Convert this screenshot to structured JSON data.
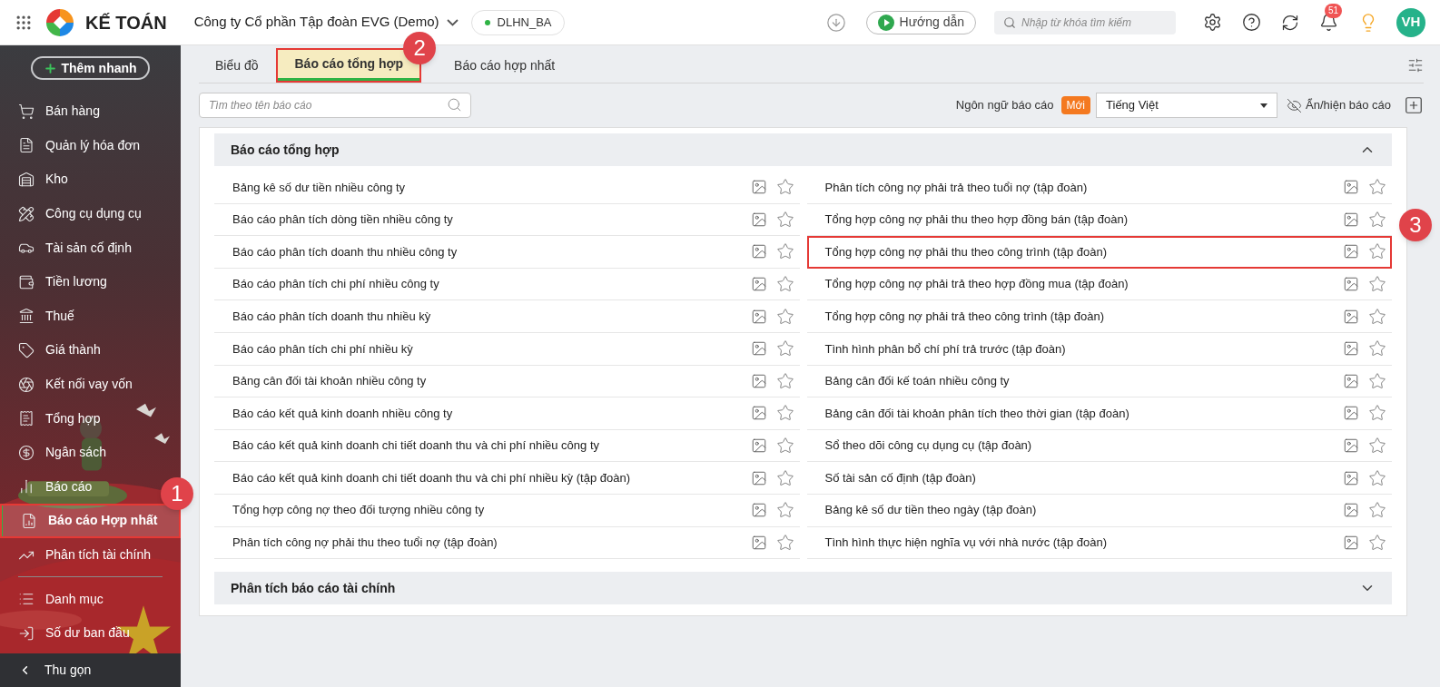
{
  "header": {
    "logo_text": "KẾ TOÁN",
    "company": "Công ty Cổ phần Tập đoàn EVG (Demo)",
    "branch": "DLHN_BA",
    "guide_button": "Hướng dẫn",
    "search_placeholder": "Nhập từ khóa tìm kiếm",
    "notification_count": "51",
    "avatar": "VH"
  },
  "sidebar": {
    "quick_add": "Thêm nhanh",
    "collapse": "Thu gọn",
    "items": [
      {
        "label": "Bán hàng",
        "selected": false
      },
      {
        "label": "Quản lý hóa đơn",
        "selected": false
      },
      {
        "label": "Kho",
        "selected": false
      },
      {
        "label": "Công cụ dụng cụ",
        "selected": false
      },
      {
        "label": "Tài sản cố định",
        "selected": false
      },
      {
        "label": "Tiền lương",
        "selected": false
      },
      {
        "label": "Thuế",
        "selected": false
      },
      {
        "label": "Giá thành",
        "selected": false
      },
      {
        "label": "Kết nối vay vốn",
        "selected": false
      },
      {
        "label": "Tổng hợp",
        "selected": false
      },
      {
        "label": "Ngân sách",
        "selected": false
      },
      {
        "label": "Báo cáo",
        "selected": false
      },
      {
        "label": "Báo cáo Hợp nhất",
        "selected": true,
        "callout": "1"
      },
      {
        "label": "Phân tích tài chính",
        "selected": false
      },
      {
        "label": "Danh mục",
        "selected": false
      },
      {
        "label": "Số dư ban đầu",
        "selected": false
      }
    ]
  },
  "tabs": [
    {
      "label": "Biểu đồ",
      "selected": false
    },
    {
      "label": "Báo cáo tổng hợp",
      "selected": true,
      "callout": "2"
    },
    {
      "label": "Báo cáo hợp nhất",
      "selected": false
    }
  ],
  "toolbar": {
    "search_placeholder": "Tìm theo tên báo cáo",
    "language_label": "Ngôn ngữ báo cáo",
    "new_badge": "Mới",
    "language_value": "Tiếng Việt",
    "toggle_label": "Ẩn/hiện báo cáo"
  },
  "sections": [
    {
      "title": "Báo cáo tổng hợp",
      "expanded": true,
      "columns": [
        [
          {
            "name": "Bảng kê số dư tiền nhiều công ty",
            "starred": false
          },
          {
            "name": "Báo cáo phân tích dòng tiền nhiều công ty",
            "starred": false
          },
          {
            "name": "Báo cáo phân tích doanh thu nhiều công ty",
            "starred": false
          },
          {
            "name": "Báo cáo phân tích chi phí nhiều công ty",
            "starred": false
          },
          {
            "name": "Báo cáo phân tích doanh thu nhiều kỳ",
            "starred": false
          },
          {
            "name": "Báo cáo phân tích chi phí nhiều kỳ",
            "starred": false
          },
          {
            "name": "Bảng cân đối tài khoản nhiều công ty",
            "starred": false
          },
          {
            "name": "Báo cáo kết quả kinh doanh nhiều công ty",
            "starred": false
          },
          {
            "name": "Báo cáo kết quả kinh doanh chi tiết doanh thu và chi phí nhiều công ty",
            "starred": false
          },
          {
            "name": "Báo cáo kết quả kinh doanh chi tiết doanh thu và chi phí nhiều kỳ (tập đoàn)",
            "starred": false
          },
          {
            "name": "Tổng hợp công nợ theo đối tượng nhiều công ty",
            "starred": false
          },
          {
            "name": "Phân tích công nợ phải thu theo tuổi nợ (tập đoàn)",
            "starred": false
          }
        ],
        [
          {
            "name": "Phân tích công nợ phải trả theo tuổi nợ (tập đoàn)",
            "starred": false
          },
          {
            "name": "Tổng hợp công nợ phải thu theo hợp đồng bán (tập đoàn)",
            "starred": false
          },
          {
            "name": "Tổng hợp công nợ phải thu theo công trình (tập đoàn)",
            "starred": false,
            "callout": "3"
          },
          {
            "name": "Tổng hợp công nợ phải trả theo hợp đồng mua (tập đoàn)",
            "starred": false
          },
          {
            "name": "Tổng hợp công nợ phải trả theo công trình (tập đoàn)",
            "starred": false
          },
          {
            "name": "Tình hình phân bổ chí phí trả trước (tập đoàn)",
            "starred": false
          },
          {
            "name": "Bảng cân đối kế toán nhiều công ty",
            "starred": false
          },
          {
            "name": "Bảng cân đối tài khoản phân tích theo thời gian (tập đoàn)",
            "starred": false
          },
          {
            "name": "Sổ theo dõi công cụ dụng cụ (tập đoàn)",
            "starred": false
          },
          {
            "name": "Số tài sản cố định (tập đoàn)",
            "starred": false
          },
          {
            "name": "Bảng kê số dư tiền theo ngày (tập đoàn)",
            "starred": false
          },
          {
            "name": "Tình hình thực hiện nghĩa vụ với nhà nước (tập đoàn)",
            "starred": false
          }
        ]
      ]
    },
    {
      "title": "Phân tích báo cáo tài chính",
      "expanded": false
    }
  ]
}
